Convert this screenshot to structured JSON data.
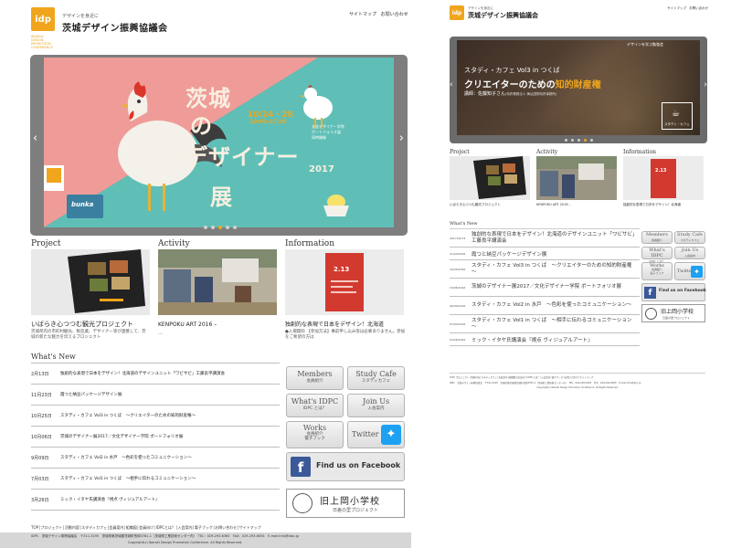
{
  "header": {
    "tagline": "デザインを身近に",
    "org_name": "茨城デザイン振興協議会",
    "org_en": [
      "IBARAKI",
      "DESIGN",
      "PROMOTION",
      "CONFERENCE"
    ],
    "logo_text": "idp",
    "nav": [
      "サイトマップ",
      "お問い合わせ"
    ]
  },
  "slider_left": {
    "title_lines": [
      "茨城",
      "の",
      "デザイナー",
      "展"
    ],
    "year": "2017",
    "dates": "10/24・28",
    "times": "10:00-17:00",
    "badge": "bunka",
    "caption": "文化デザイナー学院\nポートフォリオ展\n同時開催",
    "prev": "‹",
    "next": "›",
    "dots": 5,
    "active_dot": 2
  },
  "slider_right": {
    "topic": "デザインを学ぶ勉強会",
    "event_line": "スタディ・カフェ Vol3 in つくば",
    "headline_a": "クリエイターのための",
    "headline_b": "知的財産権",
    "speaker": "講師：佐藤知子さん",
    "speaker_note": "(特許業務法人 梅弘国際特許事務所)",
    "cafe_label": "スタディ・カフェ",
    "prev": "‹",
    "next": "›",
    "dots": 5,
    "active_dot": 3
  },
  "sections": {
    "project": {
      "heading": "Project",
      "title": "いばらき心つつむ観光プロジェクト",
      "desc": "茨城県内の市町村観光、製造業、デザイナー等が連携して、茨城の新たな魅力を伝えるプロジェクト"
    },
    "activity": {
      "heading": "Activity",
      "title": "KENPOKU ART 2016 –",
      "desc": "…"
    },
    "information": {
      "heading": "Information",
      "title": "独創的な表現で日本をデザイン！北海道",
      "desc": "●入場無料 【参加方法】事前申し込み等は必要ありません。参加をご希望の方は"
    }
  },
  "sections_right": {
    "project_title": "いばらき心つつむ観光プロジェクト",
    "activity_title": "KENPOKU ART 2016 –",
    "information_title": "独創的な表現で日本をデザイン！北海道"
  },
  "news": {
    "heading": "What's New",
    "items": [
      {
        "date": "2月13日",
        "title": "独創的な表現で日本をデザイン！北海道のデザインユニット「ワビサビ」工藤良平講演会"
      },
      {
        "date": "11月23日",
        "title": "霞つと納豆パッケージデザイン展"
      },
      {
        "date": "10月25日",
        "title": "スタディ・カフェ Vol3 in つくば　～クリエイターのための知的財産権～"
      },
      {
        "date": "10月06日",
        "title": "茨城のデザイナー展2017／文化デザイナー学院 ポートフォリオ展"
      },
      {
        "date": "9月09日",
        "title": "スタディ・カフェ Vol2 in 水戸　～色彩を使ったコミュニケーション～"
      },
      {
        "date": "7月03日",
        "title": "スタディ・カフェ Vol1 in つくば　～相手に伝わるコミュニケーション～"
      },
      {
        "date": "3月26日",
        "title": "ミック・イタヤ氏講演会『視点 ヴィジュアルアート』"
      }
    ]
  },
  "news_right": {
    "heading": "What's New",
    "items": [
      {
        "date": "2017/02/13",
        "title": "独創的な表現で日本をデザイン！北海道のデザインユニット「ワビサビ」工藤良平講演会"
      },
      {
        "date": "11/23/2016",
        "title": "霞つと納豆パッケージデザイン展"
      },
      {
        "date": "10/25/2016",
        "title": "スタディ・カフェ Vol3 in つくば　～クリエイターのための知的財産権～"
      },
      {
        "date": "10/06/2016",
        "title": "茨城のデザイナー展2017／文化デザイナー学院 ポートフォリオ展"
      },
      {
        "date": "09/09/2016",
        "title": "スタディ・カフェ Vol2 in 水戸　～色彩を使ったコミュニケーション～"
      },
      {
        "date": "07/03/2016",
        "title": "スタディ・カフェ Vol1 in つくば　～相手に伝わるコミュニケーション～"
      },
      {
        "date": "03/26/2016",
        "title": "ミック・イタヤ氏講演会『視点 ヴィジュアルアート』"
      }
    ]
  },
  "side_buttons": {
    "members": {
      "label": "Members",
      "sub": "会員紹介"
    },
    "study_cafe": {
      "label": "Study Cafe",
      "sub": "スタディカフェ"
    },
    "whats_idpc": {
      "label": "What's IDPC",
      "sub": "IDPC とは？"
    },
    "join_us": {
      "label": "Join Us",
      "sub": "入会案内"
    },
    "works": {
      "label": "Works",
      "sub": "会員紹介\n電子ブック"
    },
    "twitter": {
      "label": "Twitter"
    },
    "facebook": {
      "label": "Find us on Facebook"
    },
    "school": {
      "label": "旧上岡小学校",
      "sub": "日差の里プロジェクト"
    }
  },
  "footer": {
    "links": "TOP│プロジェクト│活動内容│スタディカフェ│会員案内│組織図│会員向け│IDPCとは？│入会案内│電子ブック│お問い合わせ│サイトマップ",
    "address": "IDPC　茨城デザイン振興協議会　〒311-3195　茨城県東茨城郡茨城町長岡3781-1（茨城県工業技術センター内）　TEL：029-293-6363　FAX：029-293-6055　E-mail:info@idpc.jp",
    "copyright": "Copyright(c) Ibaraki Design Promotion Conference. All Rights Reserved."
  },
  "colors": {
    "accent": "#f0a51c",
    "poster_pink": "#ef9c98",
    "poster_teal": "#5fbfb7",
    "facebook": "#3b5998",
    "twitter": "#1da1f2"
  }
}
